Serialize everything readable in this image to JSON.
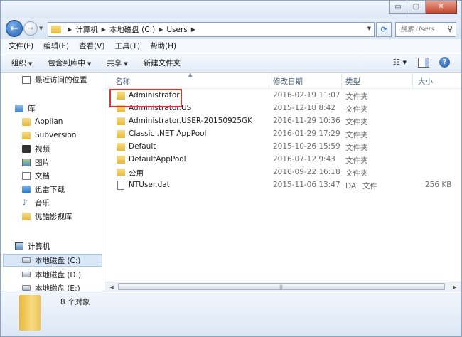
{
  "window": {
    "min_label": "▭",
    "max_label": "▢",
    "close_label": "✕"
  },
  "nav": {
    "back_label": "←",
    "forward_label": "→"
  },
  "address": {
    "crumbs": [
      "计算机",
      "本地磁盘 (C:)",
      "Users"
    ]
  },
  "search": {
    "placeholder": "搜索 Users"
  },
  "menu": [
    "文件(F)",
    "编辑(E)",
    "查看(V)",
    "工具(T)",
    "帮助(H)"
  ],
  "toolbar": {
    "organize": "组织",
    "include_library": "包含到库中",
    "share": "共享",
    "new_folder": "新建文件夹"
  },
  "sidebar": {
    "recent": "最近访问的位置",
    "libraries": "库",
    "library_items": [
      "Applian",
      "Subversion",
      "视频",
      "图片",
      "文档",
      "迅雷下载",
      "音乐",
      "优酷影视库"
    ],
    "computer": "计算机",
    "drives": [
      "本地磁盘 (C:)",
      "本地磁盘 (D:)",
      "本地磁盘 (E:)"
    ]
  },
  "columns": {
    "name": "名称",
    "date": "修改日期",
    "type": "类型",
    "size": "大小"
  },
  "files": [
    {
      "name": "Administrator",
      "date": "2016-02-19 11:07",
      "type": "文件夹",
      "size": "",
      "kind": "folder"
    },
    {
      "name": "Administrator.US",
      "date": "2015-12-18 8:42",
      "type": "文件夹",
      "size": "",
      "kind": "folder"
    },
    {
      "name": "Administrator.USER-20150925GK",
      "date": "2016-11-29 10:36",
      "type": "文件夹",
      "size": "",
      "kind": "folder"
    },
    {
      "name": "Classic .NET AppPool",
      "date": "2016-01-29 17:29",
      "type": "文件夹",
      "size": "",
      "kind": "folder"
    },
    {
      "name": "Default",
      "date": "2015-10-26 15:59",
      "type": "文件夹",
      "size": "",
      "kind": "folder"
    },
    {
      "name": "DefaultAppPool",
      "date": "2016-07-12 9:43",
      "type": "文件夹",
      "size": "",
      "kind": "folder"
    },
    {
      "name": "公用",
      "date": "2016-09-22 16:18",
      "type": "文件夹",
      "size": "",
      "kind": "folder"
    },
    {
      "name": "NTUser.dat",
      "date": "2015-11-06 13:47",
      "type": "DAT 文件",
      "size": "256 KB",
      "kind": "file"
    }
  ],
  "status": {
    "count": "8 个对象"
  }
}
